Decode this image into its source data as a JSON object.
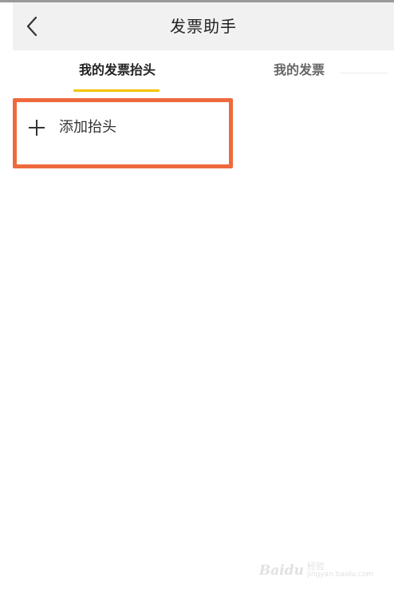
{
  "navbar": {
    "title": "发票助手",
    "back_icon": "chevron-left-icon"
  },
  "tabs": [
    {
      "label": "我的发票抬头",
      "active": true
    },
    {
      "label": "我的发票",
      "active": false
    }
  ],
  "add_header": {
    "label": "添加抬头",
    "icon": "plus-icon"
  },
  "colors": {
    "accent_underline": "#f2c300",
    "highlight_border": "#ee6a3c",
    "navbar_bg": "#f1f1f1"
  },
  "watermark": {
    "brand": "Baidu",
    "cn": "经验",
    "domain": "jingyan.baidu.com"
  }
}
